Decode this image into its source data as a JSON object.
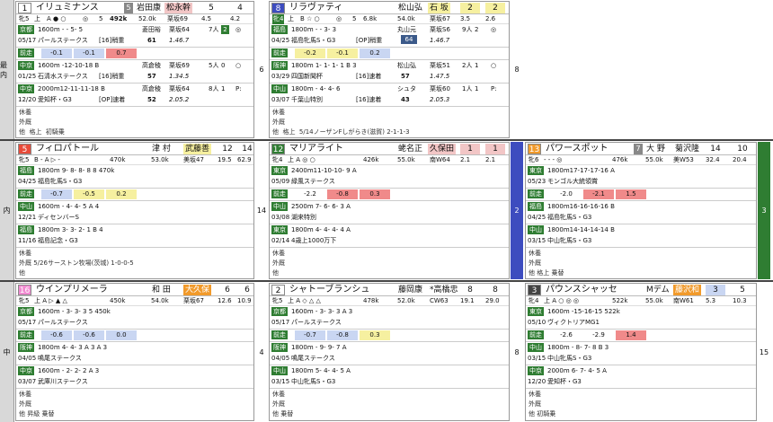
{
  "lanes": [
    "最内",
    "内",
    "中"
  ],
  "rows": [
    {
      "gate_label": "8",
      "cards": [
        {
          "num": "1",
          "numcolor": "#ffffff",
          "name": "イリュミナンス",
          "num2": "5",
          "jockey": "岩田康",
          "jockey2": "松永幹",
          "o1": "5",
          "o2": "4",
          "sub": [
            "牝5",
            "上",
            "A ● ○",
            "◎",
            "5",
            "492k",
            "52.0k",
            "栗坂69",
            "4.5",
            "4.2"
          ],
          "races": [
            {
              "tag": "京都",
              "date": "05/17",
              "l1": "1600m  - - 5- 5",
              "l2": "パールステークス",
              "grade": "[16]稍重",
              "sex": "",
              "jc": "菱田裕",
              "wt": "61",
              "rate": "栗坂64",
              "time": "1.46.7",
              "rank": "7人",
              "pos": "2",
              "mark": "◎",
              "mark2": "○"
            },
            {
              "tag": "中京",
              "date": "01/25",
              "l1": "1600m  -12-10-18 B",
              "l2": "石清水ステークス",
              "grade": "[16]稍重",
              "jc": "高倉稜",
              "wt": "57",
              "rate": "栗坂69",
              "time": "1.34.5",
              "rank": "5人",
              "pos": "0",
              "mark": "○"
            },
            {
              "tag": "中京",
              "date": "12/20",
              "l1": "2000m12-11-11-18 B",
              "l2": "愛知杯・G3",
              "grade": "[OP]速着",
              "jc": "高倉稜",
              "wt": "52",
              "rate": "栗坂64",
              "time": "2.05.2",
              "rank": "8人",
              "pos": "1",
              "mark": "P:"
            }
          ],
          "pace": [
            "-0.1",
            "-0.1",
            "0.7"
          ],
          "foot": [
            "休養",
            "外厩",
            "他",
            "格上",
            "初騎乗"
          ]
        },
        {
          "num": "8",
          "numcolor": "#3d4cbf",
          "name": "リラヴァティ",
          "num2": "",
          "jockey": "松山弘",
          "jockey2": "石 坂",
          "o1": "2",
          "o2": "2",
          "sub": [
            "牝4",
            "上",
            "B ☆ ○",
            "◎",
            "5",
            "6.8k",
            "54.0k",
            "栗坂67",
            "3.5",
            "2.6"
          ],
          "races": [
            {
              "tag": "福島",
              "date": "04/25",
              "l1": "1800m  - - 3- 3",
              "l2": "福島牝馬S・G3",
              "grade": "[OP]稍重",
              "jc": "丸山元",
              "wt": "64",
              "rate": "栗坂S6",
              "time": "1.46.7",
              "rank": "9人",
              "pos": "2",
              "mark": "◎"
            },
            {
              "tag": "阪神",
              "date": "03/29",
              "l1": "1800m 1- 1- 1- 1 B 3",
              "l2": "四国新聞杯",
              "grade": "[16]速着",
              "jc": "松山弘",
              "wt": "57",
              "rate": "栗坂51",
              "time": "1.47.5",
              "rank": "2人",
              "pos": "1",
              "mark": "○"
            },
            {
              "tag": "中山",
              "date": "03/07",
              "l1": "1800m  - 4- 4- 6",
              "l2": "千葉山特別",
              "grade": "[16]速着",
              "jc": "シュタ",
              "wt": "43",
              "rate": "栗坂60",
              "time": "2.05.3",
              "rank": "1人",
              "pos": "1",
              "mark": "P:"
            }
          ],
          "pace": [
            "-0.2",
            "-0.1",
            "0.2"
          ],
          "foot": [
            "休養",
            "外厩",
            "他",
            "格上",
            "5/14ノーザンFしがらき(滋賀)  2-1-1-3"
          ]
        }
      ]
    }
  ]
}
